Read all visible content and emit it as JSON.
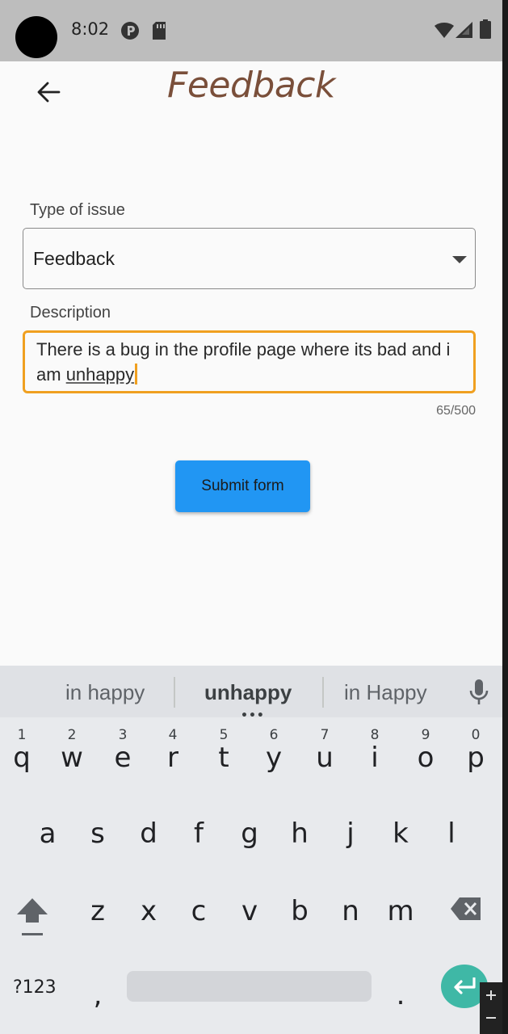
{
  "status_bar": {
    "time": "8:02"
  },
  "app_bar": {
    "title": "Feedback"
  },
  "form": {
    "issue_type_label": "Type of issue",
    "issue_type_value": "Feedback",
    "description_label": "Description",
    "description_text_plain": "There is a bug in the profile page where its bad and i am ",
    "description_text_composing": "unhappy",
    "char_counter": "65/500",
    "submit_label": "Submit form"
  },
  "keyboard": {
    "suggestions": [
      "in happy",
      "unhappy",
      "in Happy"
    ],
    "row1": [
      {
        "ch": "q",
        "num": "1"
      },
      {
        "ch": "w",
        "num": "2"
      },
      {
        "ch": "e",
        "num": "3"
      },
      {
        "ch": "r",
        "num": "4"
      },
      {
        "ch": "t",
        "num": "5"
      },
      {
        "ch": "y",
        "num": "6"
      },
      {
        "ch": "u",
        "num": "7"
      },
      {
        "ch": "i",
        "num": "8"
      },
      {
        "ch": "o",
        "num": "9"
      },
      {
        "ch": "p",
        "num": "0"
      }
    ],
    "row2": [
      "a",
      "s",
      "d",
      "f",
      "g",
      "h",
      "j",
      "k",
      "l"
    ],
    "row3": [
      "z",
      "x",
      "c",
      "v",
      "b",
      "n",
      "m"
    ],
    "symbols_label": "?123",
    "comma": ",",
    "period": "."
  },
  "colors": {
    "title": "#7a4f3a",
    "focus_border": "#f0a020",
    "submit_bg": "#2196f3",
    "enter_bg": "#3fb8a6"
  }
}
